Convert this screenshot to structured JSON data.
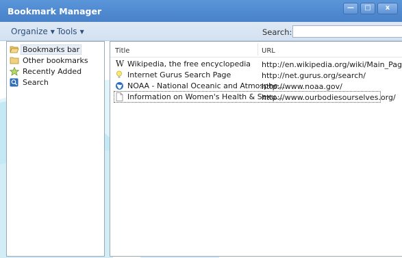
{
  "window": {
    "title": "Bookmark Manager",
    "controls": {
      "minimize": "—",
      "maximize": "□",
      "close": "x"
    }
  },
  "toolbar": {
    "organize_label": "Organize",
    "tools_label": "Tools",
    "search_label": "Search:",
    "search_value": "",
    "search_placeholder": ""
  },
  "sidebar": {
    "items": [
      {
        "label": "Bookmarks bar",
        "icon": "folder-open-icon"
      },
      {
        "label": "Other bookmarks",
        "icon": "folder-icon"
      },
      {
        "label": "Recently Added",
        "icon": "star-icon"
      },
      {
        "label": "Search",
        "icon": "search-icon"
      }
    ]
  },
  "list": {
    "columns": {
      "title": "Title",
      "url": "URL"
    },
    "rows": [
      {
        "title": "Wikipedia, the free encyclopedia",
        "url": "http://en.wikipedia.org/wiki/Main_Page",
        "icon": "wikipedia-icon"
      },
      {
        "title": "Internet Gurus Search Page",
        "url": "http://net.gurus.org/search/",
        "icon": "lightbulb-icon"
      },
      {
        "title": "NOAA - National Oceanic and Atmosphe...",
        "url": "http://www.noaa.gov/",
        "icon": "noaa-icon"
      },
      {
        "title": "Information on Women's Health & Sexu...",
        "url": "http://www.ourbodiesourselves.org/",
        "icon": "page-icon"
      }
    ]
  },
  "colors": {
    "titlebar": "#4f89d0",
    "toolbar": "#d9e5f3",
    "menu_text": "#2c4f7c",
    "watermark": "#8fd0e8"
  }
}
